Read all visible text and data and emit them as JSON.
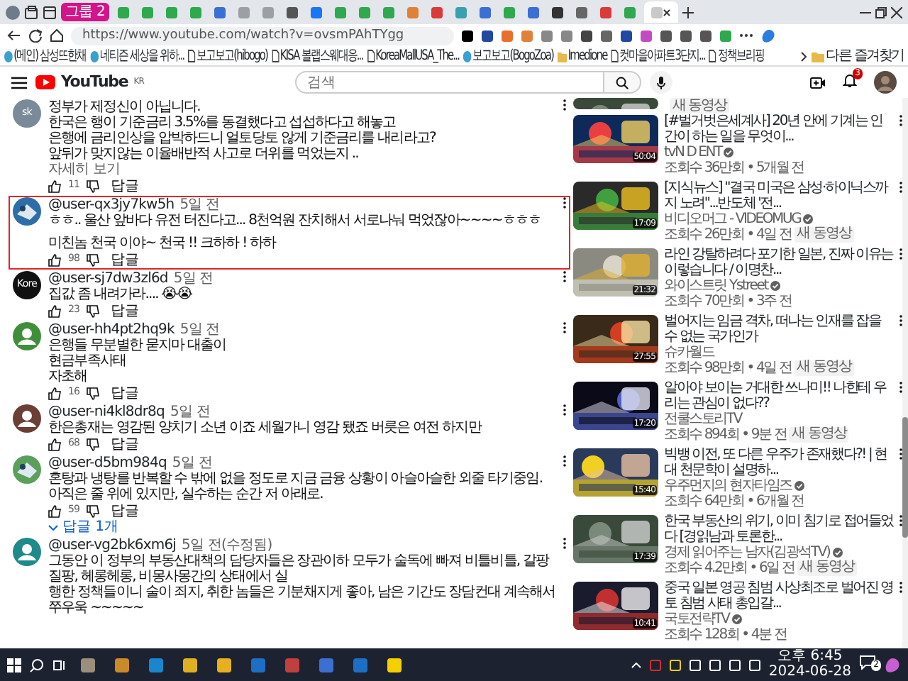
{
  "browser": {
    "tab_group": "그룹 2",
    "tabs": [
      {
        "color": "#2fa84f",
        "selected": false
      },
      {
        "color": "#2fa84f",
        "selected": false
      },
      {
        "color": "#2fa84f",
        "selected": false
      },
      {
        "color": "#2fa84f",
        "selected": false
      },
      {
        "color": "#3b6fd1",
        "selected": false
      },
      {
        "color": "#9aa0a6",
        "selected": false
      },
      {
        "color": "#9aa0a6",
        "selected": false
      },
      {
        "color": "#555555",
        "selected": false
      },
      {
        "color": "#1877f2",
        "selected": false
      },
      {
        "color": "#2fa84f",
        "selected": false
      },
      {
        "color": "#2fa84f",
        "selected": false
      },
      {
        "color": "#2fa84f",
        "selected": false
      },
      {
        "color": "#e0813a",
        "selected": false
      },
      {
        "color": "#d93a3a",
        "selected": false
      },
      {
        "color": "#3aa0b0",
        "selected": false
      },
      {
        "color": "#3b6fd1",
        "selected": false
      },
      {
        "color": "#2fa84f",
        "selected": false
      },
      {
        "color": "#3b6fd1",
        "selected": false
      },
      {
        "color": "#333333",
        "selected": false
      },
      {
        "color": "#666666",
        "selected": false
      },
      {
        "color": "#d93a3a",
        "selected": false
      },
      {
        "color": "#2fa84f",
        "selected": false
      },
      {
        "color": "#c9c9c9",
        "selected": true
      }
    ],
    "url": "https://www.youtube.com/watch?v=ovsmPAhTYgg",
    "bookmarks": [
      {
        "label": "(메인) 삼성뜨한채",
        "kind": "site"
      },
      {
        "label": "네티즌 세상을 위하...",
        "kind": "site"
      },
      {
        "label": "보고보고(hibogo)",
        "kind": "page"
      },
      {
        "label": "KISA 볼랩스웨대응...",
        "kind": "page"
      },
      {
        "label": "KoreaMallUSA_The...",
        "kind": "page"
      },
      {
        "label": "보고보고(BogoZoa)",
        "kind": "site"
      },
      {
        "label": "Imedione",
        "kind": "folder"
      },
      {
        "label": "컷마을아파트3단지...",
        "kind": "page"
      },
      {
        "label": "정책브리핑",
        "kind": "page"
      }
    ],
    "other_bookmarks": "다른 즐겨찾기"
  },
  "header": {
    "logo": "YouTube",
    "region": "KR",
    "search_placeholder": "검색",
    "notification_count": "3"
  },
  "comments": [
    {
      "avatar": {
        "kind": "letters",
        "text": "sk",
        "color": "#7a8a99"
      },
      "highlighted": false,
      "lines": [
        "정부가 제정신이 아닙니다.",
        "한국은 행이 기준금리 3.5%를 동결했다고 섭섭하다고 해놓고",
        "은행에 금리인상을 압박하드니 얼토당토 않게 기준금리를 내리라고?",
        "앞뒤가 맞지않는 이율배반적 사고로 더위를 먹었는지 .."
      ],
      "more": "자세히 보기",
      "likes": "11",
      "reply": "답글"
    },
    {
      "author": "@user-qx3jy7kw5h",
      "time": "5일 전",
      "avatar": {
        "kind": "picture",
        "color": "#2d6ea8"
      },
      "highlighted": true,
      "lines": [
        "ㅎㅎ.. 울산 앞바다 유전 터진다고... 8천억원 잔치해서 서로나눠 먹었잖아~~~~ㅎㅎㅎ"
      ],
      "second_paragraph": [
        "미친놈 천국 이야~ 천국 !! 크하하 ! 하하"
      ],
      "likes": "98",
      "reply": "답글"
    },
    {
      "author": "@user-sj7dw3zl6d",
      "time": "5일 전",
      "avatar": {
        "kind": "letters",
        "text": "Kore",
        "color": "#111111"
      },
      "highlighted": false,
      "lines": [
        "집값 좀 내려가라.... 😭😭"
      ],
      "likes": "23",
      "reply": "답글"
    },
    {
      "author": "@user-hh4pt2hq9k",
      "time": "5일 전",
      "avatar": {
        "kind": "default",
        "color": "#3f8f3a"
      },
      "highlighted": false,
      "lines": [
        "은행들 무분별한 묻지마 대출이",
        "현금부족사태",
        "자초해"
      ],
      "likes": "16",
      "reply": "답글"
    },
    {
      "author": "@user-ni4kl8dr8q",
      "time": "5일 전",
      "avatar": {
        "kind": "default",
        "color": "#6b3f35"
      },
      "highlighted": false,
      "lines": [
        "한은총재는 영감된 양치기 소년 이죠 세월가니 영감 됐죠 버릇은 여전 하지만"
      ],
      "likes": "68",
      "reply": "답글"
    },
    {
      "author": "@user-d5bm984q",
      "time": "5일 전",
      "avatar": {
        "kind": "picture",
        "color": "#5aa05a"
      },
      "highlighted": false,
      "lines": [
        "혼탕과 냉탕를 반복할 수 밖에 없을 정도로 지금 금융 상황이 아슬아슬한 외줄 타기중임.",
        "아직은 줄 위에 있지만, 실수하는 순간 저 아래로."
      ],
      "likes": "59",
      "reply": "답글",
      "replies": "답글 1개"
    },
    {
      "author": "@user-vg2bk6xm6j",
      "time": "5일 전(수정됨)",
      "avatar": {
        "kind": "default",
        "color": "#1e8a8a"
      },
      "highlighted": false,
      "lines": [
        "그동안 이 정부의 부동산대책의 담당자들은 장관이하 모두가 술독에 빠져 비틀비틀, 갈팡질팡, 헤롱헤롱, 비몽사몽간의 상태에서 실",
        "행한 정책들이니 술이 죄지, 취한 놈들은  기분채지게 좋아, 남은 기간도 장담컨대  계속해서 쭈우욱 ~~~~~"
      ]
    }
  ],
  "videos": [
    {
      "badge": "새 동영상"
    },
    {
      "title": "[#벌거벗은세계사] 20년 안에 기계는 인간이 하는 일을 무엇이...",
      "channel": "tvN D ENT",
      "verified": true,
      "views": "조회수 36만회 • 5개월 전",
      "duration": "50:04"
    },
    {
      "title": "[지식뉴스] \"결국 미국은 삼성·하이닉스까지 노려\"...반도체 '전...",
      "channel": "비디오머그 - VIDEOMUG",
      "verified": true,
      "views": "조회수 26만회 • 4일 전",
      "badge": "새 동영상",
      "duration": "17:09"
    },
    {
      "title": "라인 강탈하려다 포기한 일본, 진짜 이유는 이렇습니다 / 이명찬...",
      "channel": "와이스트릿 Ystreet",
      "verified": true,
      "views": "조회수 70만회 • 3주 전",
      "duration": "21:32"
    },
    {
      "title": "벌어지는 임금 격차, 떠나는 인재를 잡을 수 없는 국가인가",
      "channel": "슈카월드",
      "verified": false,
      "views": "조회수 98만회 • 4일 전",
      "badge": "새 동영상",
      "duration": "27:55"
    },
    {
      "title": "알아야 보이는 거대한 쓰나미!! 나한테 우리는 관심이 없다??",
      "channel": "전쿨스토리TV",
      "verified": false,
      "views": "조회수 894회 • 9분 전",
      "badge": "새 동영상",
      "duration": "17:20"
    },
    {
      "title": "빅뱅 이전, 또 다른 우주가 존재했다?! | 현대 천문학이 설명하...",
      "channel": "우주먼지의 현자타임즈",
      "verified": true,
      "views": "조회수 64만회 • 6개월 전",
      "duration": "15:40"
    },
    {
      "title": "한국 부동산의 위기, 이미 침기로 접어들었다 [경읽남과 토론한...",
      "channel": "경제 읽어주는 남자(김광석TV)",
      "verified": true,
      "views": "조회수 4.2만회 • 6일 전",
      "badge": "새 동영상",
      "duration": "17:39"
    },
    {
      "title": "중국 일본 영공 침범 사상최조로 벌어진 영토 침범 사태 총입갈...",
      "channel": "국토전략TV",
      "verified": true,
      "views": "조회수 128회 • 4분 전",
      "duration": "10:41"
    }
  ],
  "taskbar": {
    "apps": [
      {
        "color": "#9a8f7a"
      },
      {
        "color": "#c98a2a"
      },
      {
        "color": "#1a86d0"
      },
      {
        "color": "#e0b020"
      },
      {
        "color": "#e8b020"
      },
      {
        "color": "#1c6fc4"
      },
      {
        "color": "#c04040"
      },
      {
        "color": "#3b6fd1"
      },
      {
        "color": "#1c6fc4"
      },
      {
        "color": "#f5d000"
      }
    ],
    "time": "오후 6:45",
    "date": "2024-06-28",
    "notifications": "2"
  }
}
